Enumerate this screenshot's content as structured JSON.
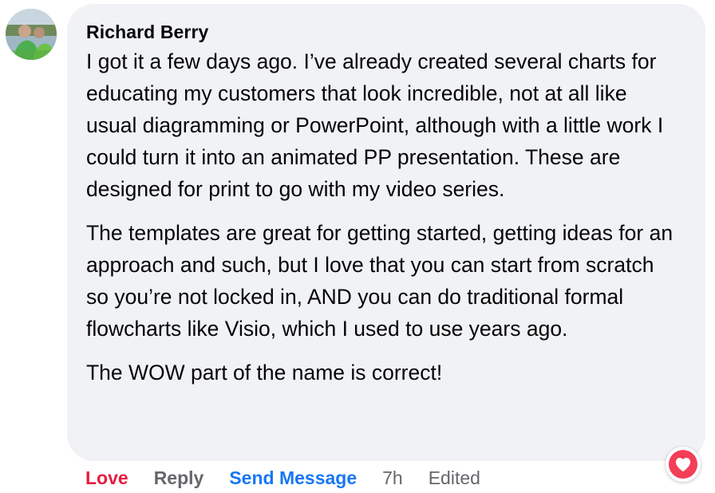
{
  "comment": {
    "author": "Richard Berry",
    "paragraphs": [
      "I got it a few days ago. I’ve already created several charts for educating my customers that look incredible, not at all like usual diagramming or PowerPoint, although with a little work I could turn it into an animated PP presentation. These are designed for print to go with my video series.",
      "The templates are great for getting started, getting ideas for an approach and such, but I love that you can start from scratch so you’re not locked in, AND you can do traditional formal flowcharts like Visio, which I used to use years ago.",
      "The WOW part of the name is correct!"
    ],
    "avatar_icon": "profile-photo"
  },
  "actions": {
    "love_label": "Love",
    "reply_label": "Reply",
    "send_message_label": "Send Message",
    "time": "7h",
    "edited": "Edited"
  },
  "reaction": {
    "icon": "heart-icon",
    "color": "#f33e58"
  },
  "colors": {
    "bubble": "#f0f2f5",
    "love": "#e41e3f",
    "link": "#1877f2",
    "muted": "#65676b"
  }
}
